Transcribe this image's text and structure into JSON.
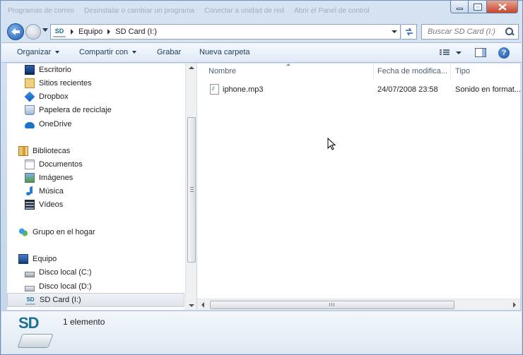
{
  "titlebar": {
    "ghost_tabs": [
      "Programas de correo",
      "Desinstalar o cambiar un programa",
      "Conectar a unidad de red",
      "Abrir el Panel de control"
    ]
  },
  "address": {
    "breadcrumb": [
      "Equipo",
      "SD Card (I:)"
    ],
    "search_placeholder": "Buscar SD Card (I:)"
  },
  "toolbar": {
    "organize": "Organizar",
    "share": "Compartir con",
    "burn": "Grabar",
    "new_folder": "Nueva carpeta"
  },
  "nav": {
    "favorites": [
      "Escritorio",
      "Sitios recientes",
      "Dropbox",
      "Papelera de reciclaje",
      "OneDrive"
    ],
    "libraries": "Bibliotecas",
    "library_items": [
      "Documentos",
      "Imágenes",
      "Música",
      "Vídeos"
    ],
    "homegroup": "Grupo en el hogar",
    "computer": "Equipo",
    "drives": [
      "Disco local (C:)",
      "Disco local (D:)",
      "SD Card (I:)"
    ]
  },
  "columns": {
    "name": "Nombre",
    "date": "Fecha de modifica...",
    "type": "Tipo"
  },
  "files": [
    {
      "name": "iphone.mp3",
      "date": "24/07/2008 23:58",
      "type": "Sonido en format..."
    }
  ],
  "details": {
    "icon_text": "SD",
    "count": "1 elemento"
  },
  "colors": {
    "accent": "#1f5fb4",
    "toolbar_text": "#1e395b",
    "header_text": "#4c607a"
  }
}
